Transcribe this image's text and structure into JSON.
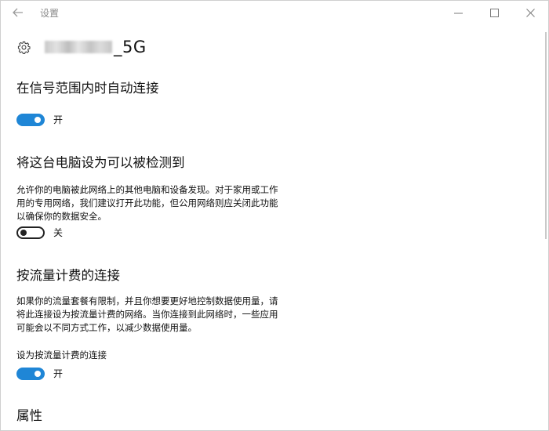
{
  "window": {
    "title": "设置",
    "back_icon": "arrow-left-icon",
    "minimize_glyph": "—",
    "maximize_glyph": "☐",
    "close_glyph": "✕"
  },
  "header": {
    "network_name_suffix": "_5G",
    "icon": "gear-icon"
  },
  "auto_connect": {
    "title": "在信号范围内时自动连接",
    "toggle_state": "开",
    "toggle_on": true
  },
  "discoverable": {
    "title": "将这台电脑设为可以被检测到",
    "description_lines": [
      "允许你的电脑被此网络上的其他电脑和设备发现。对于家用或工作",
      "用的专用网络，我们建议打开此功能，但公用网络则应关闭此功能",
      "以确保你的数据安全。"
    ],
    "toggle_state": "关",
    "toggle_on": false
  },
  "metered": {
    "title": "按流量计费的连接",
    "description_lines": [
      "如果你的流量套餐有限制，并且你想要更好地控制数据使用量，请",
      "将此连接设为按流量计费的网络。当你连接到此网络时，一些应用",
      "可能会以不同方式工作，以减少数据使用量。"
    ],
    "setting_label": "设为按流量计费的连接",
    "toggle_state": "开",
    "toggle_on": true
  },
  "properties": {
    "title": "属性"
  },
  "colors": {
    "toggle_on": "#1f86d6",
    "toggle_off_border": "#222222"
  }
}
